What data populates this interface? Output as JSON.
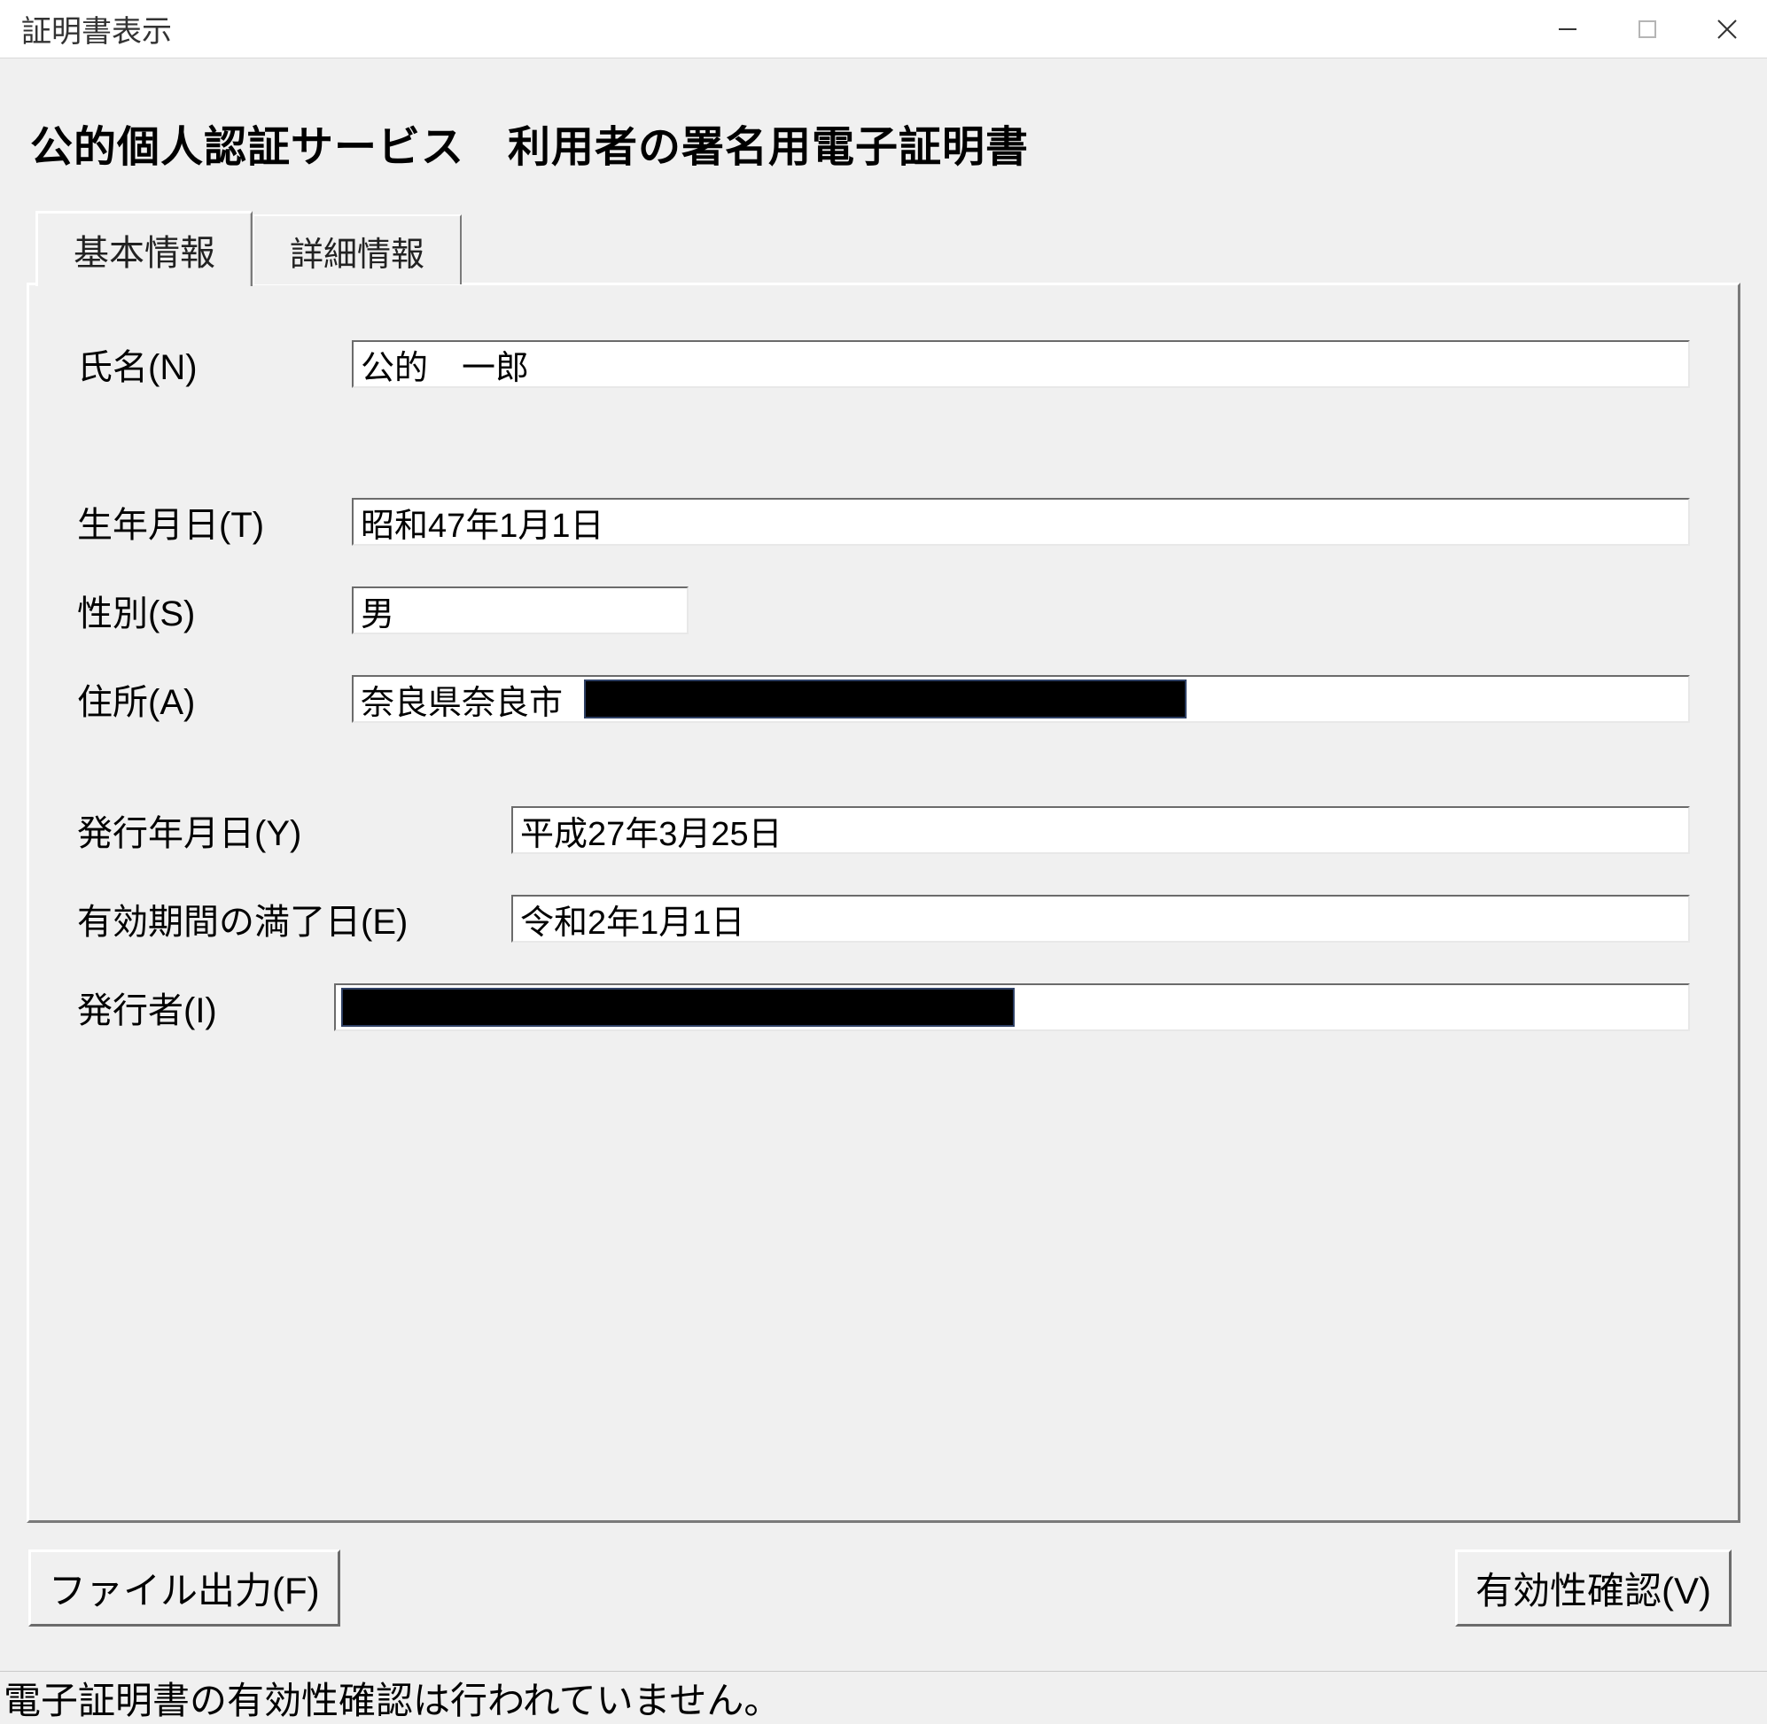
{
  "titlebar": {
    "title": "証明書表示"
  },
  "heading": "公的個人認証サービス　利用者の署名用電子証明書",
  "tabs": {
    "basic": "基本情報",
    "detail": "詳細情報"
  },
  "labels": {
    "name": "氏名(N)",
    "birthdate": "生年月日(T)",
    "gender": "性別(S)",
    "address": "住所(A)",
    "issue_date": "発行年月日(Y)",
    "expiry_date": "有効期間の満了日(E)",
    "issuer": "発行者(I)"
  },
  "values": {
    "name": "公的　一郎",
    "birthdate": "昭和47年1月1日",
    "gender": "男",
    "address_prefix": "奈良県奈良市",
    "issue_date": "平成27年3月25日",
    "expiry_date": "令和2年1月1日",
    "issuer": ""
  },
  "buttons": {
    "file_output": "ファイル出力(F)",
    "validate": "有効性確認(V)"
  },
  "status": "電子証明書の有効性確認は行われていません。"
}
